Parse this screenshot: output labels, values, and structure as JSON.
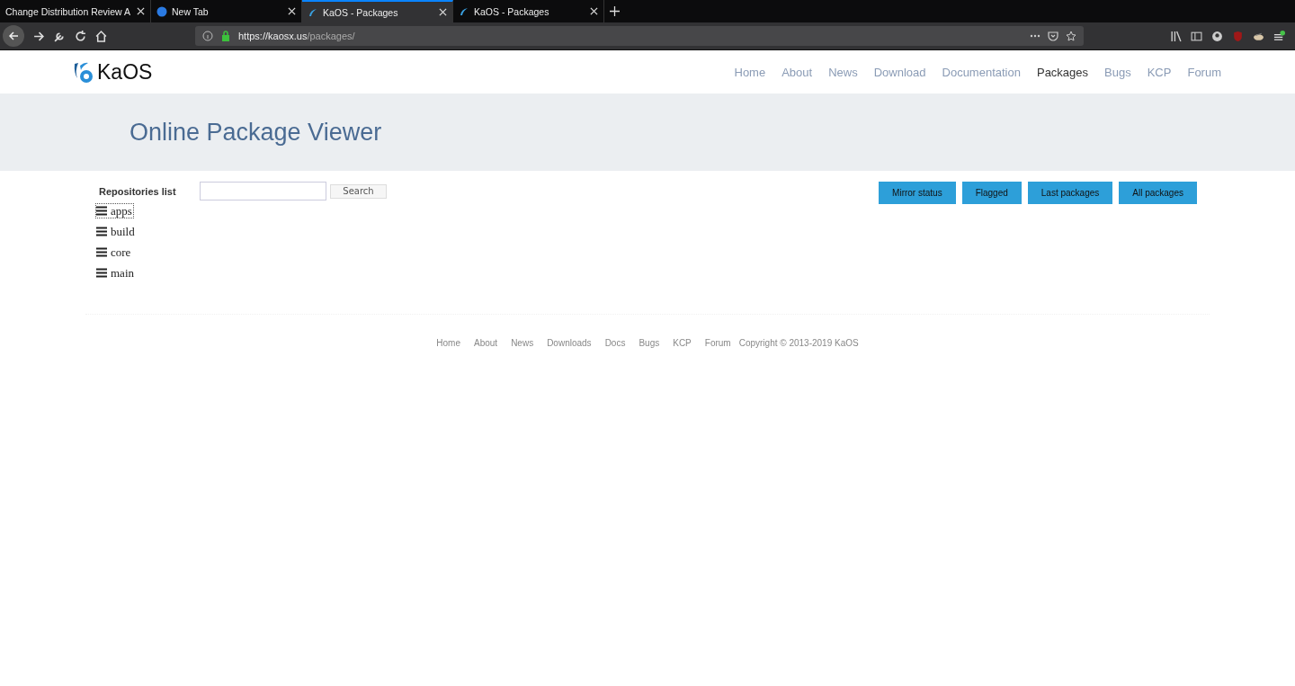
{
  "browser": {
    "tabs": [
      {
        "title": "Change Distribution Review A",
        "kind": "plain",
        "selected": false
      },
      {
        "title": "New Tab",
        "kind": "browser",
        "selected": false
      },
      {
        "title": "KaOS - Packages",
        "kind": "site",
        "selected": true
      },
      {
        "title": "KaOS - Packages",
        "kind": "site",
        "selected": false
      }
    ],
    "url": {
      "host": "https://kaosx.us",
      "path": "/packages/"
    }
  },
  "site": {
    "logo": "KaOS",
    "nav": [
      {
        "label": "Home",
        "selected": false
      },
      {
        "label": "About",
        "selected": false
      },
      {
        "label": "News",
        "selected": false
      },
      {
        "label": "Download",
        "selected": false
      },
      {
        "label": "Documentation",
        "selected": false
      },
      {
        "label": "Packages",
        "selected": true
      },
      {
        "label": "Bugs",
        "selected": false
      },
      {
        "label": "KCP",
        "selected": false
      },
      {
        "label": "Forum",
        "selected": false
      }
    ],
    "heading": "Online Package Viewer"
  },
  "viewer": {
    "repos_label": "Repositories list",
    "search_button": "Search",
    "actions": [
      "Mirror status",
      "Flagged",
      "Last packages",
      "All packages"
    ],
    "repositories": [
      {
        "name": "apps",
        "selected": true
      },
      {
        "name": "build",
        "selected": false
      },
      {
        "name": "core",
        "selected": false
      },
      {
        "name": "main",
        "selected": false
      }
    ]
  },
  "footer": {
    "links": [
      "Home",
      "About",
      "News",
      "Downloads",
      "Docs",
      "Bugs",
      "KCP",
      "Forum"
    ],
    "copyright": "Copyright © 2013-2019 KaOS"
  }
}
